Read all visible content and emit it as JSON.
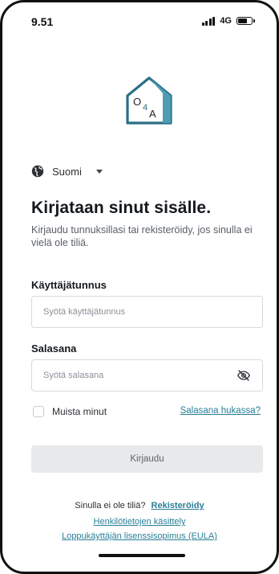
{
  "status_bar": {
    "time": "9.51",
    "network": "4G",
    "battery_level": 0.7
  },
  "colors": {
    "accent": "#2a7f98",
    "logo_stroke": "#2a6f86",
    "logo_wall": "#4e9bb2",
    "button_bg": "#e8e9eb"
  },
  "logo": {
    "letter_o": "O",
    "number_4": "4",
    "letter_a": "A"
  },
  "language": {
    "icon": "globe-icon",
    "selected": "Suomi"
  },
  "login": {
    "title": "Kirjataan sinut sisälle.",
    "subtitle": "Kirjaudu tunnuksillasi tai rekisteröidy, jos sinulla ei vielä ole tiliä.",
    "username_label": "Käyttäjätunnus",
    "username_placeholder": "Syötä käyttäjätunnus",
    "username_value": "",
    "password_label": "Salasana",
    "password_placeholder": "Syötä salasana",
    "password_value": "",
    "password_toggle_icon": "eye-off-icon",
    "remember_label": "Muista minut",
    "remember_checked": false,
    "forgot_link": "Salasana hukassa?",
    "submit_label": "Kirjaudu"
  },
  "footer": {
    "no_account_text": "Sinulla ei ole tiliä?",
    "register_link": "Rekisteröidy",
    "privacy_link": "Henkilötietojen käsittely",
    "eula_link": "Loppukäyttäjän lisenssisopimus (EULA)"
  }
}
